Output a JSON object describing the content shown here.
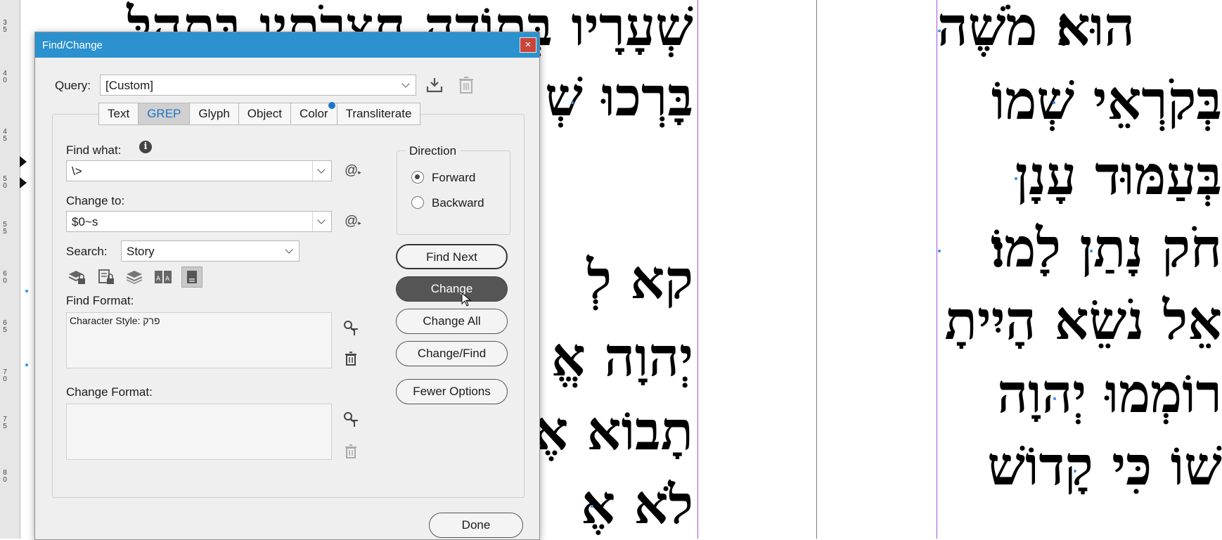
{
  "ruler": {
    "labels": [
      "3",
      "5",
      "4",
      "0",
      "4",
      "5",
      "5",
      "0",
      "5",
      "5",
      "6",
      "0",
      "6",
      "5",
      "7",
      "0",
      "7",
      "5",
      "8",
      "0"
    ]
  },
  "document": {
    "left_lines": [
      "שְׁעָרָיו בְּתוֹדָה חֲצֵרֹתָיו בִּתְהִלָּ",
      "בָּרְכוּ שְׁ",
      "",
      "קא לְ",
      "יְהוָה אֱ",
      "תָבוֹא אֶ",
      "לֹא אֶ"
    ],
    "right_lines": [
      "הוּא׃ מֹשֶׁה",
      "בְּקֹרְאֵי שְׁמוֹ",
      "בְּעַמּוּד עָנָן",
      "חֹק נָתַן לָמוֹ׃",
      "אֵל נֹשֵׂא הָיִיתָ",
      "רוֹמְמוּ יְהוָה",
      "שׁוֹ כִּי קָדוֹשׁ"
    ]
  },
  "dialog": {
    "title": "Find/Change",
    "close_glyph": "×",
    "query_label": "Query:",
    "query_value": "[Custom]",
    "tabs": [
      "Text",
      "GREP",
      "Glyph",
      "Object",
      "Color",
      "Transliterate"
    ],
    "active_tab": "GREP",
    "find_what_label": "Find what:",
    "find_what_value": "\\>",
    "change_to_label": "Change to:",
    "change_to_value": "$0~s",
    "search_label": "Search:",
    "search_value": "Story",
    "find_format_label": "Find Format:",
    "find_format_value": "Character  Style: פרק",
    "change_format_label": "Change Format:",
    "change_format_value": "",
    "direction_label": "Direction",
    "forward_label": "Forward",
    "backward_label": "Backward",
    "direction_selected": "Forward",
    "buttons": {
      "find_next": "Find Next",
      "change": "Change",
      "change_all": "Change All",
      "change_find": "Change/Find",
      "fewer_options": "Fewer Options",
      "done": "Done"
    },
    "special_char_glyph": "@",
    "info_glyph": "i",
    "colors": {
      "titlebar": "#2b91cf",
      "accent": "#1d73c9",
      "close": "#c8463c",
      "guide": "#a64dd1"
    }
  }
}
